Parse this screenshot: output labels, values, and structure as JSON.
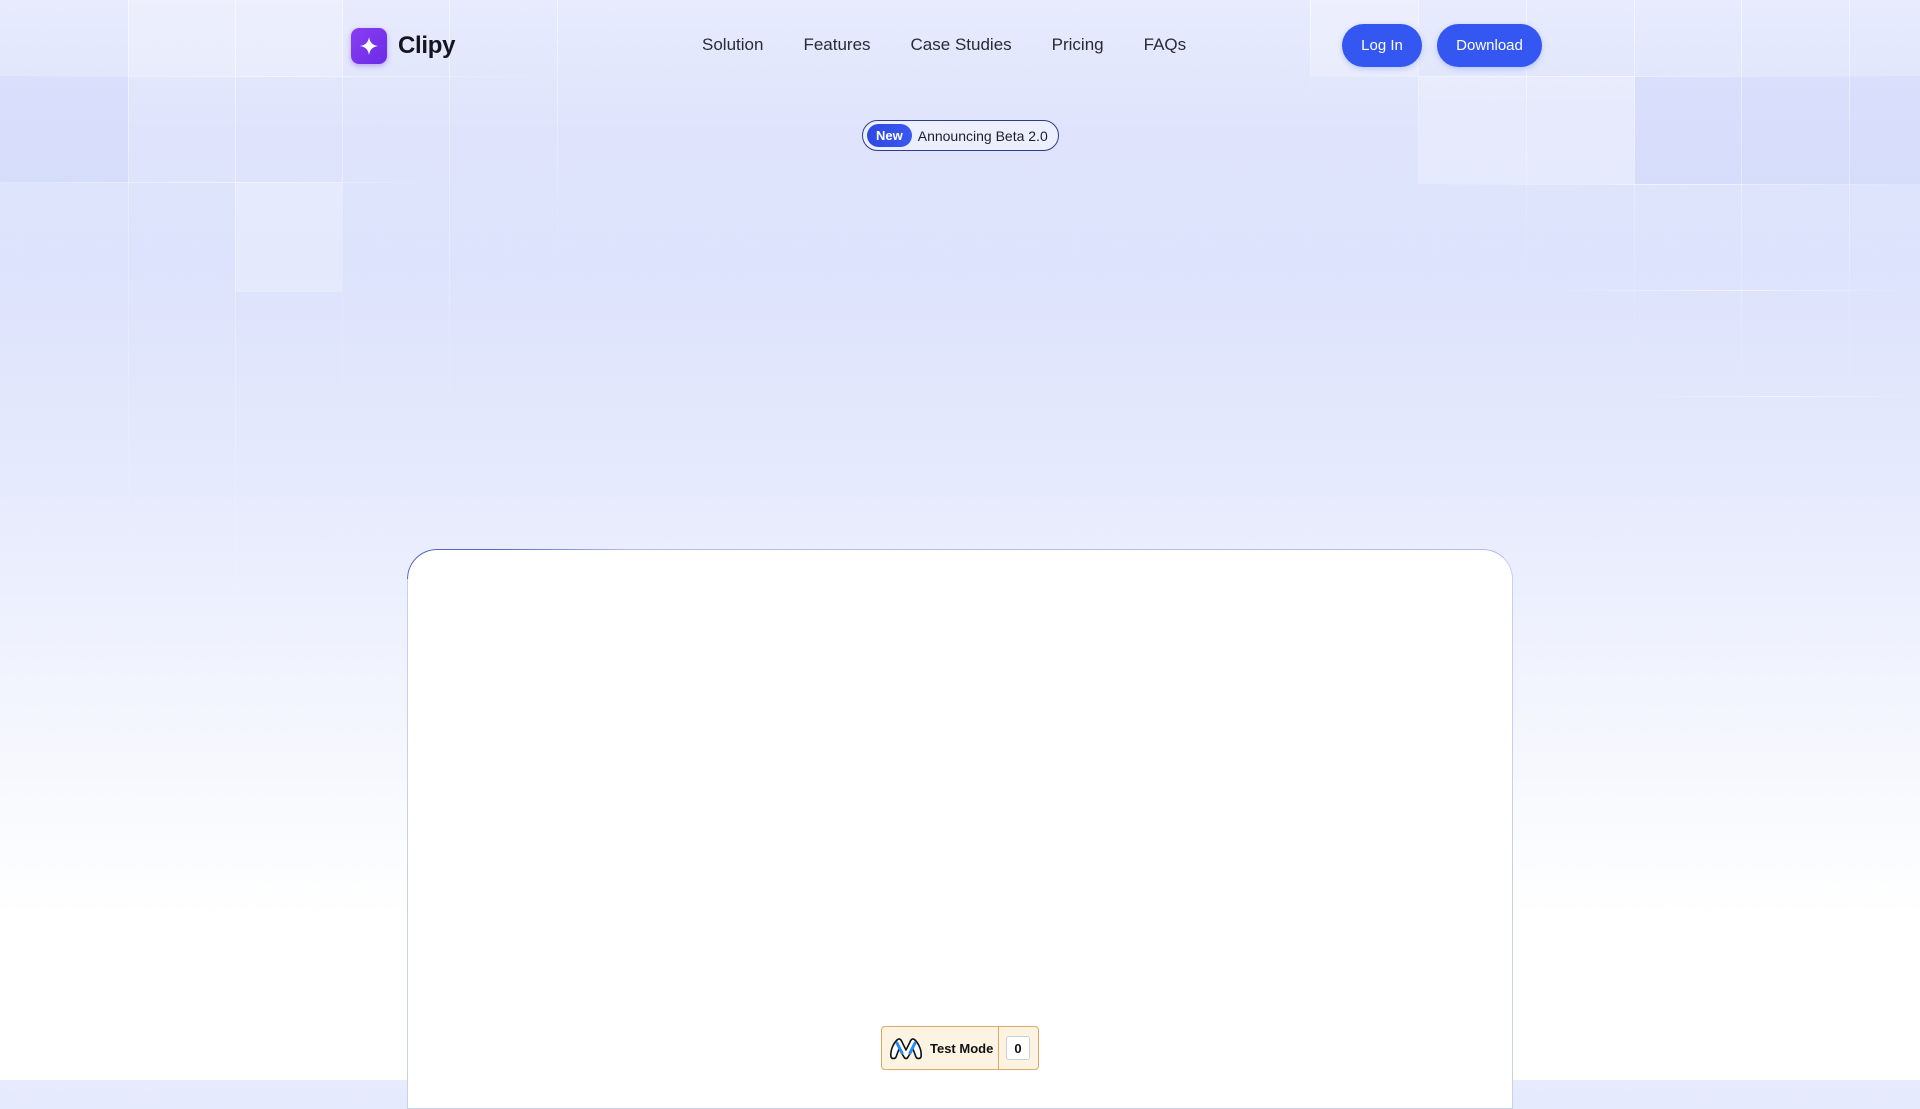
{
  "brand": {
    "name": "Clipy",
    "accent": "#7a35ee"
  },
  "nav": {
    "items": [
      {
        "label": "Solution"
      },
      {
        "label": "Features"
      },
      {
        "label": "Case Studies"
      },
      {
        "label": "Pricing"
      },
      {
        "label": "FAQs"
      }
    ]
  },
  "actions": {
    "login_label": "Log In",
    "download_label": "Download",
    "button_color": "#3357f0"
  },
  "announcement": {
    "badge": "New",
    "text": "Announcing Beta 2.0"
  },
  "test_mode": {
    "label": "Test Mode",
    "count": "0",
    "logo_icon": "mountain-logo-icon"
  }
}
